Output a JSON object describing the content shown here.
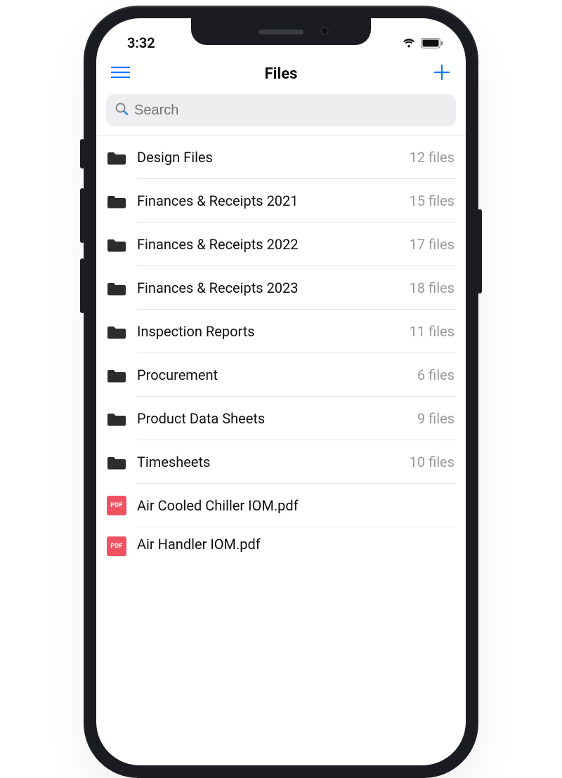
{
  "status": {
    "time": "3:32"
  },
  "header": {
    "title": "Files"
  },
  "search": {
    "placeholder": "Search"
  },
  "folders": [
    {
      "name": "Design Files",
      "detail": "12 files"
    },
    {
      "name": "Finances & Receipts 2021",
      "detail": "15 files"
    },
    {
      "name": "Finances & Receipts 2022",
      "detail": "17 files"
    },
    {
      "name": "Finances & Receipts 2023",
      "detail": "18 files"
    },
    {
      "name": "Inspection Reports",
      "detail": "11 files"
    },
    {
      "name": "Procurement",
      "detail": "6 files"
    },
    {
      "name": "Product Data Sheets",
      "detail": "9 files"
    },
    {
      "name": "Timesheets",
      "detail": "10 files"
    }
  ],
  "files": [
    {
      "name": "Air Cooled Chiller IOM.pdf",
      "badge": "PDF"
    },
    {
      "name": "Air Handler IOM.pdf",
      "badge": "PDF"
    }
  ],
  "colors": {
    "accent": "#0a7aff",
    "pdf": "#ef5261"
  }
}
